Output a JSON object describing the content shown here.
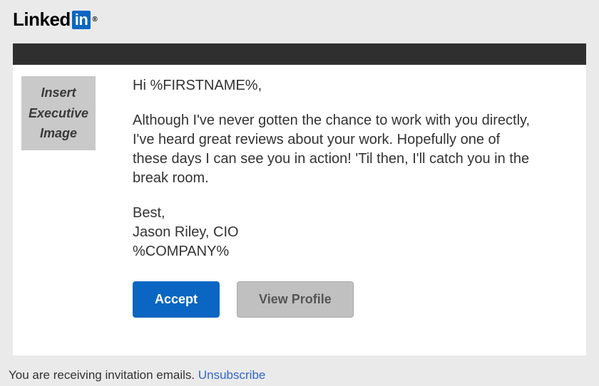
{
  "logo": {
    "text_linked": "Linked",
    "text_in": "in",
    "reg": "®"
  },
  "avatar": {
    "line1": "Insert",
    "line2": "Executive",
    "line3": "Image"
  },
  "message": {
    "greeting": "Hi %FIRSTNAME%,",
    "body": "Although I've never gotten the chance to work with you directly, I've heard great reviews about your work. Hopefully one of these days I can see you in action! 'Til then, I'll catch you in the break room.",
    "signoff": "Best,",
    "sender_name": "Jason Riley, CIO",
    "sender_company": "%COMPANY%"
  },
  "buttons": {
    "accept": "Accept",
    "view_profile": "View Profile"
  },
  "footer": {
    "text": "You are receiving invitation emails. ",
    "unsubscribe": "Unsubscribe"
  }
}
